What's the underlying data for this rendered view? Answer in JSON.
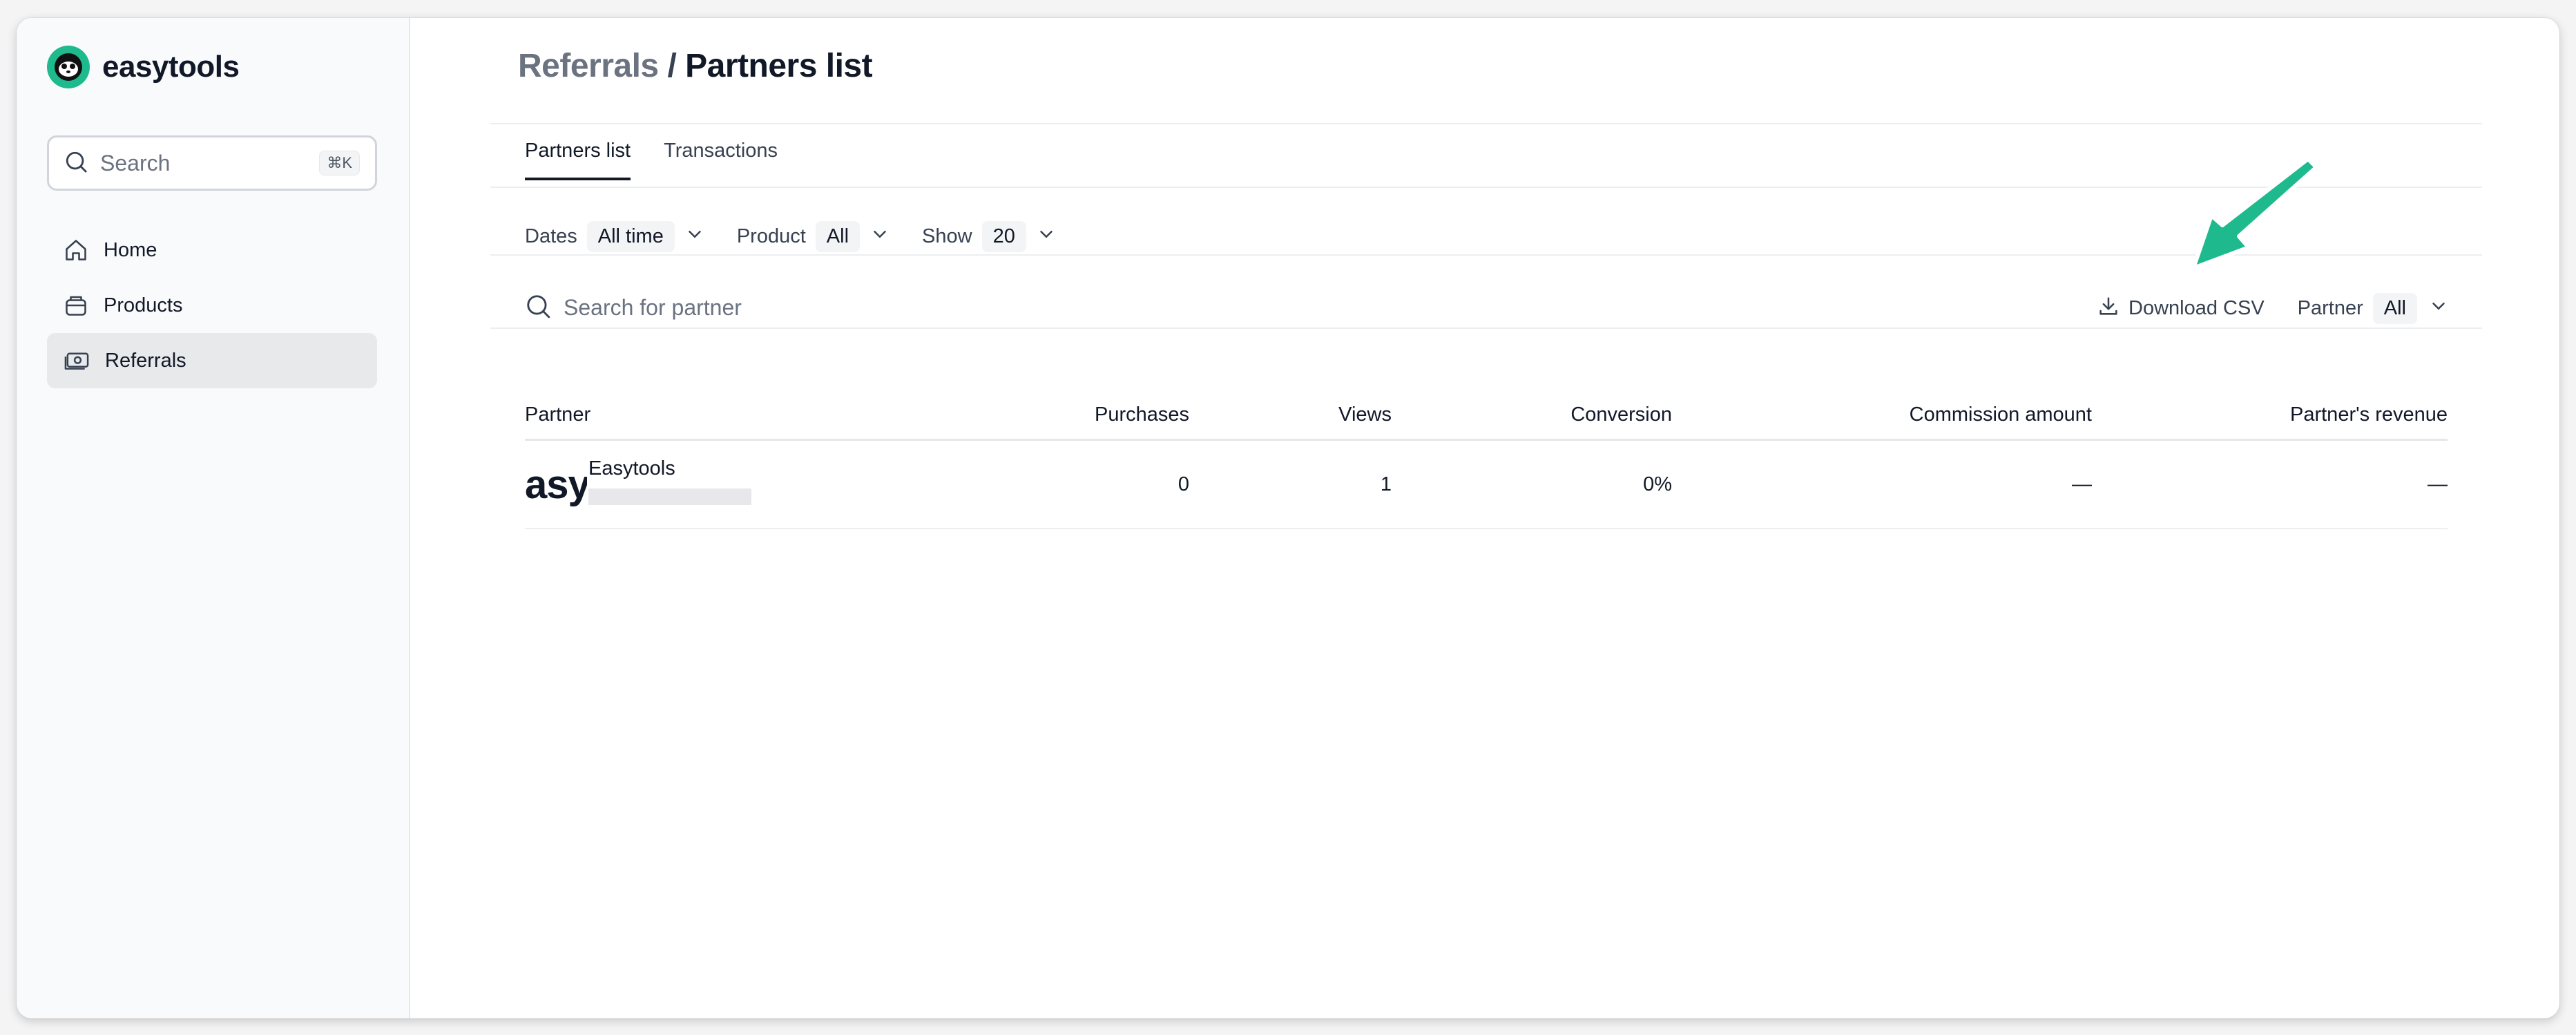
{
  "brand": {
    "name": "easytools"
  },
  "sidebar": {
    "search": {
      "placeholder": "Search",
      "shortcut": "⌘K"
    },
    "items": [
      {
        "label": "Home",
        "icon": "home-icon",
        "active": false
      },
      {
        "label": "Products",
        "icon": "box-icon",
        "active": false
      },
      {
        "label": "Referrals",
        "icon": "money-icon",
        "active": true
      }
    ]
  },
  "header": {
    "breadcrumb_parent": "Referrals",
    "separator": "/",
    "title": "Partners list"
  },
  "tabs": [
    {
      "label": "Partners list",
      "active": true
    },
    {
      "label": "Transactions",
      "active": false
    }
  ],
  "filters": {
    "dates": {
      "label": "Dates",
      "value": "All time"
    },
    "product": {
      "label": "Product",
      "value": "All"
    },
    "show": {
      "label": "Show",
      "value": "20"
    }
  },
  "partner_search": {
    "placeholder": "Search for partner"
  },
  "toolbar": {
    "download_label": "Download CSV",
    "partner_filter": {
      "label": "Partner",
      "value": "All"
    }
  },
  "table": {
    "columns": [
      "Partner",
      "Purchases",
      "Views",
      "Conversion",
      "Commission amount",
      "Partner's revenue"
    ],
    "rows": [
      {
        "logo_text": "asy",
        "name": "Easytools",
        "purchases": "0",
        "views": "1",
        "conversion": "0%",
        "commission": "—",
        "revenue": "—"
      }
    ]
  },
  "colors": {
    "accent": "#1fb98e",
    "arrow": "#1fb98e",
    "active_nav_bg": "#e8e9eb"
  }
}
